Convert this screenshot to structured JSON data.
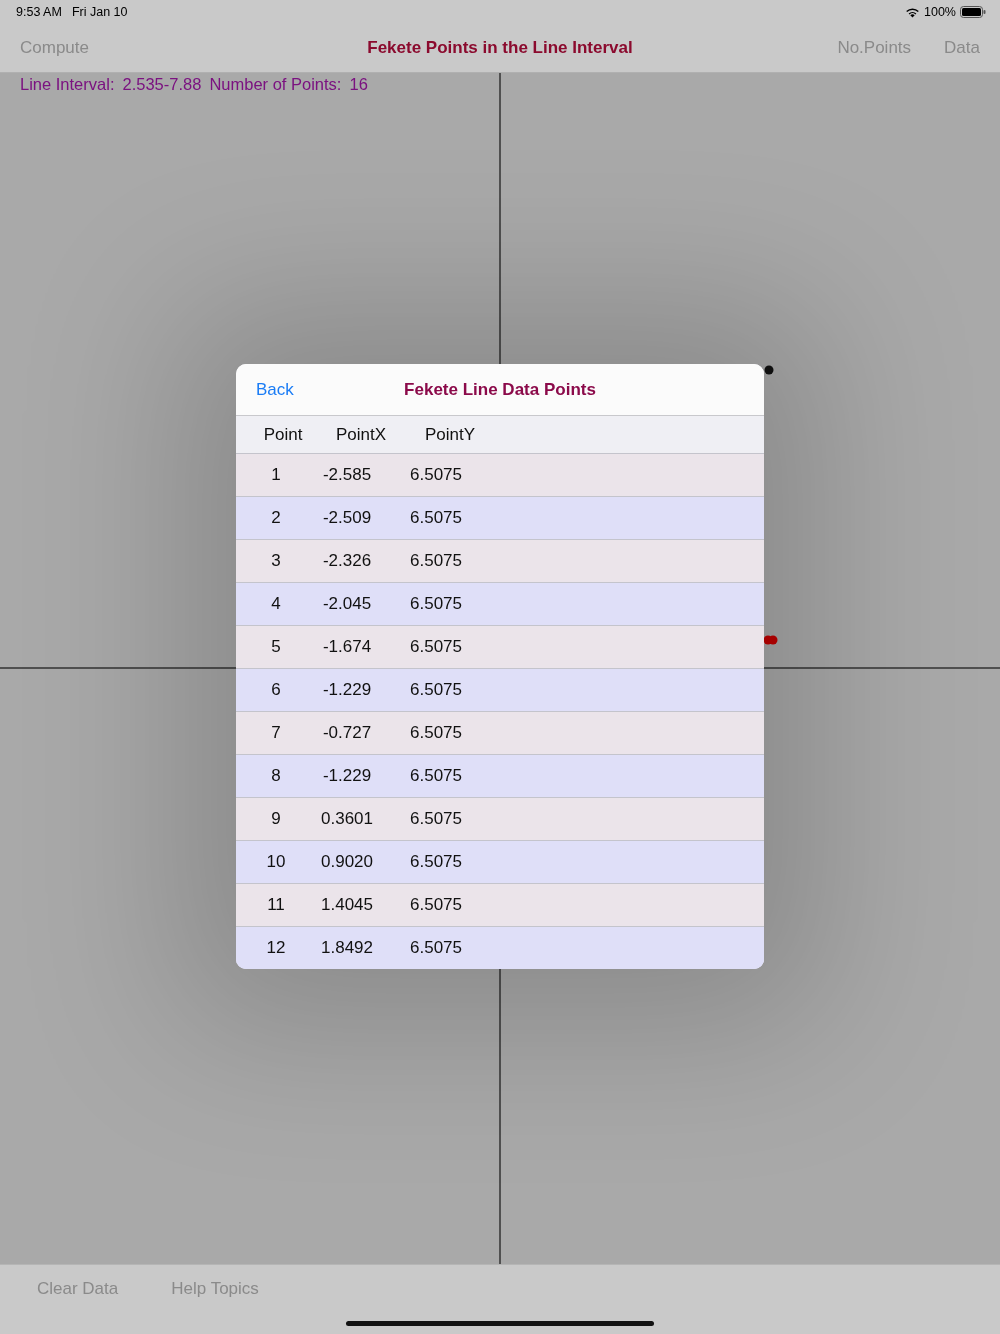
{
  "status_bar": {
    "time": "9:53 AM",
    "date": "Fri Jan 10",
    "battery": "100%"
  },
  "nav_bar": {
    "left_button": "Compute",
    "title": "Fekete Points in the Line Interval",
    "right_buttons": [
      "No.Points",
      "Data"
    ]
  },
  "info": {
    "interval_label": "Line Interval:",
    "interval": "2.535-7.88",
    "count_label": "Number of Points:",
    "count": "16"
  },
  "modal": {
    "back": "Back",
    "title": "Fekete Line Data Points",
    "columns": [
      "Point",
      "PointX",
      "PointY"
    ],
    "rows": [
      [
        "1",
        "-2.585",
        "6.5075"
      ],
      [
        "2",
        "-2.509",
        "6.5075"
      ],
      [
        "3",
        "-2.326",
        "6.5075"
      ],
      [
        "4",
        "-2.045",
        "6.5075"
      ],
      [
        "5",
        "-1.674",
        "6.5075"
      ],
      [
        "6",
        "-1.229",
        "6.5075"
      ],
      [
        "7",
        "-0.727",
        "6.5075"
      ],
      [
        "8",
        "-1.229",
        "6.5075"
      ],
      [
        "9",
        "0.3601",
        "6.5075"
      ],
      [
        "10",
        "0.9020",
        "6.5075"
      ],
      [
        "11",
        "1.4045",
        "6.5075"
      ],
      [
        "12",
        "1.8492",
        "6.5075"
      ]
    ]
  },
  "toolbar": {
    "buttons": [
      "Clear Data",
      "Help Topics"
    ]
  }
}
